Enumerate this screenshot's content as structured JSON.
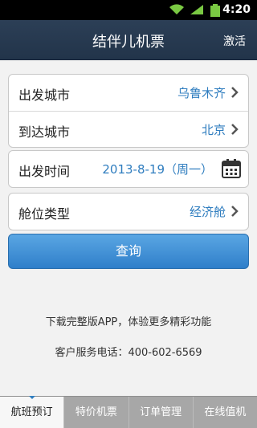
{
  "status_bar": {
    "time": "4:20",
    "wifi_icon": "wifi-icon",
    "signal_icon": "signal-icon",
    "battery_icon": "battery-icon"
  },
  "header": {
    "title": "结伴儿机票",
    "action_label": "激活"
  },
  "form": {
    "departure": {
      "label": "出发城市",
      "value": "乌鲁木齐"
    },
    "arrival": {
      "label": "到达城市",
      "value": "北京"
    },
    "date": {
      "label": "出发时间",
      "value": "2013-8-19（周一）"
    },
    "cabin": {
      "label": "舱位类型",
      "value": "经济舱"
    }
  },
  "query_button": {
    "label": "查询"
  },
  "info": {
    "promo": "下载完整版APP，体验更多精彩功能",
    "hotline": "客户服务电话：400-602-6569"
  },
  "tabs": [
    {
      "label": "航班预订",
      "active": true
    },
    {
      "label": "特价机票",
      "active": false
    },
    {
      "label": "订单管理",
      "active": false
    },
    {
      "label": "在线值机",
      "active": false
    }
  ],
  "colors": {
    "accent": "#2f7dbf",
    "header_bg": "#22344a",
    "button_bg": "#4a97d8"
  }
}
